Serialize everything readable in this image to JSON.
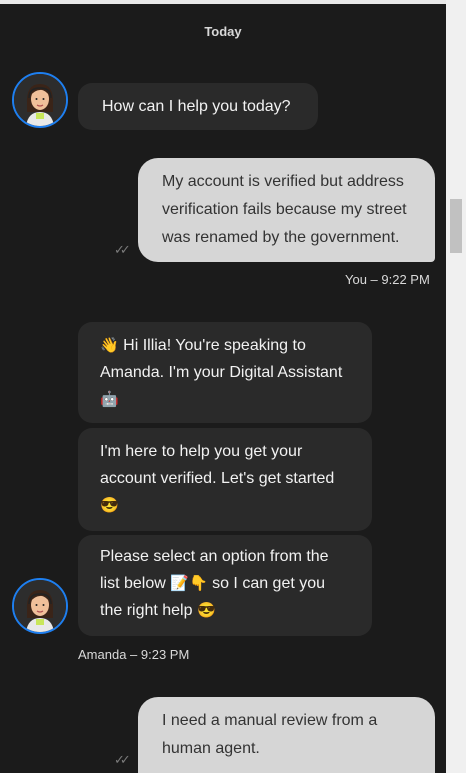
{
  "date_separator": "Today",
  "messages": {
    "greeting": "How can I help you today?",
    "user1": "My account is verified but address verification fails because my street was renamed by the government.",
    "user1_meta": "You – 9:22 PM",
    "agent1_emoji_a": "👋",
    "agent1_text": "Hi Illia! You're speaking to Amanda. I'm your Digital Assistant",
    "agent1_emoji_b": "🤖",
    "agent2_text": "I'm here to help you get your account verified. Let's get started",
    "agent2_emoji": "😎",
    "agent3_text_a": "Please select an option from the list below",
    "agent3_emoji_a": "📝👇",
    "agent3_text_b": "so I can get you the right help",
    "agent3_emoji_b": "😎",
    "agent_meta": "Amanda – 9:23 PM",
    "user2": "I need a manual review from a human agent."
  },
  "icons": {
    "avatar": "agent-avatar-icon",
    "read_receipt": "double-check-icon"
  },
  "colors": {
    "background": "#1b1b1b",
    "agent_bubble": "#2a2a2a",
    "user_bubble": "#d6d6d6",
    "avatar_ring": "#1e7ff0"
  }
}
